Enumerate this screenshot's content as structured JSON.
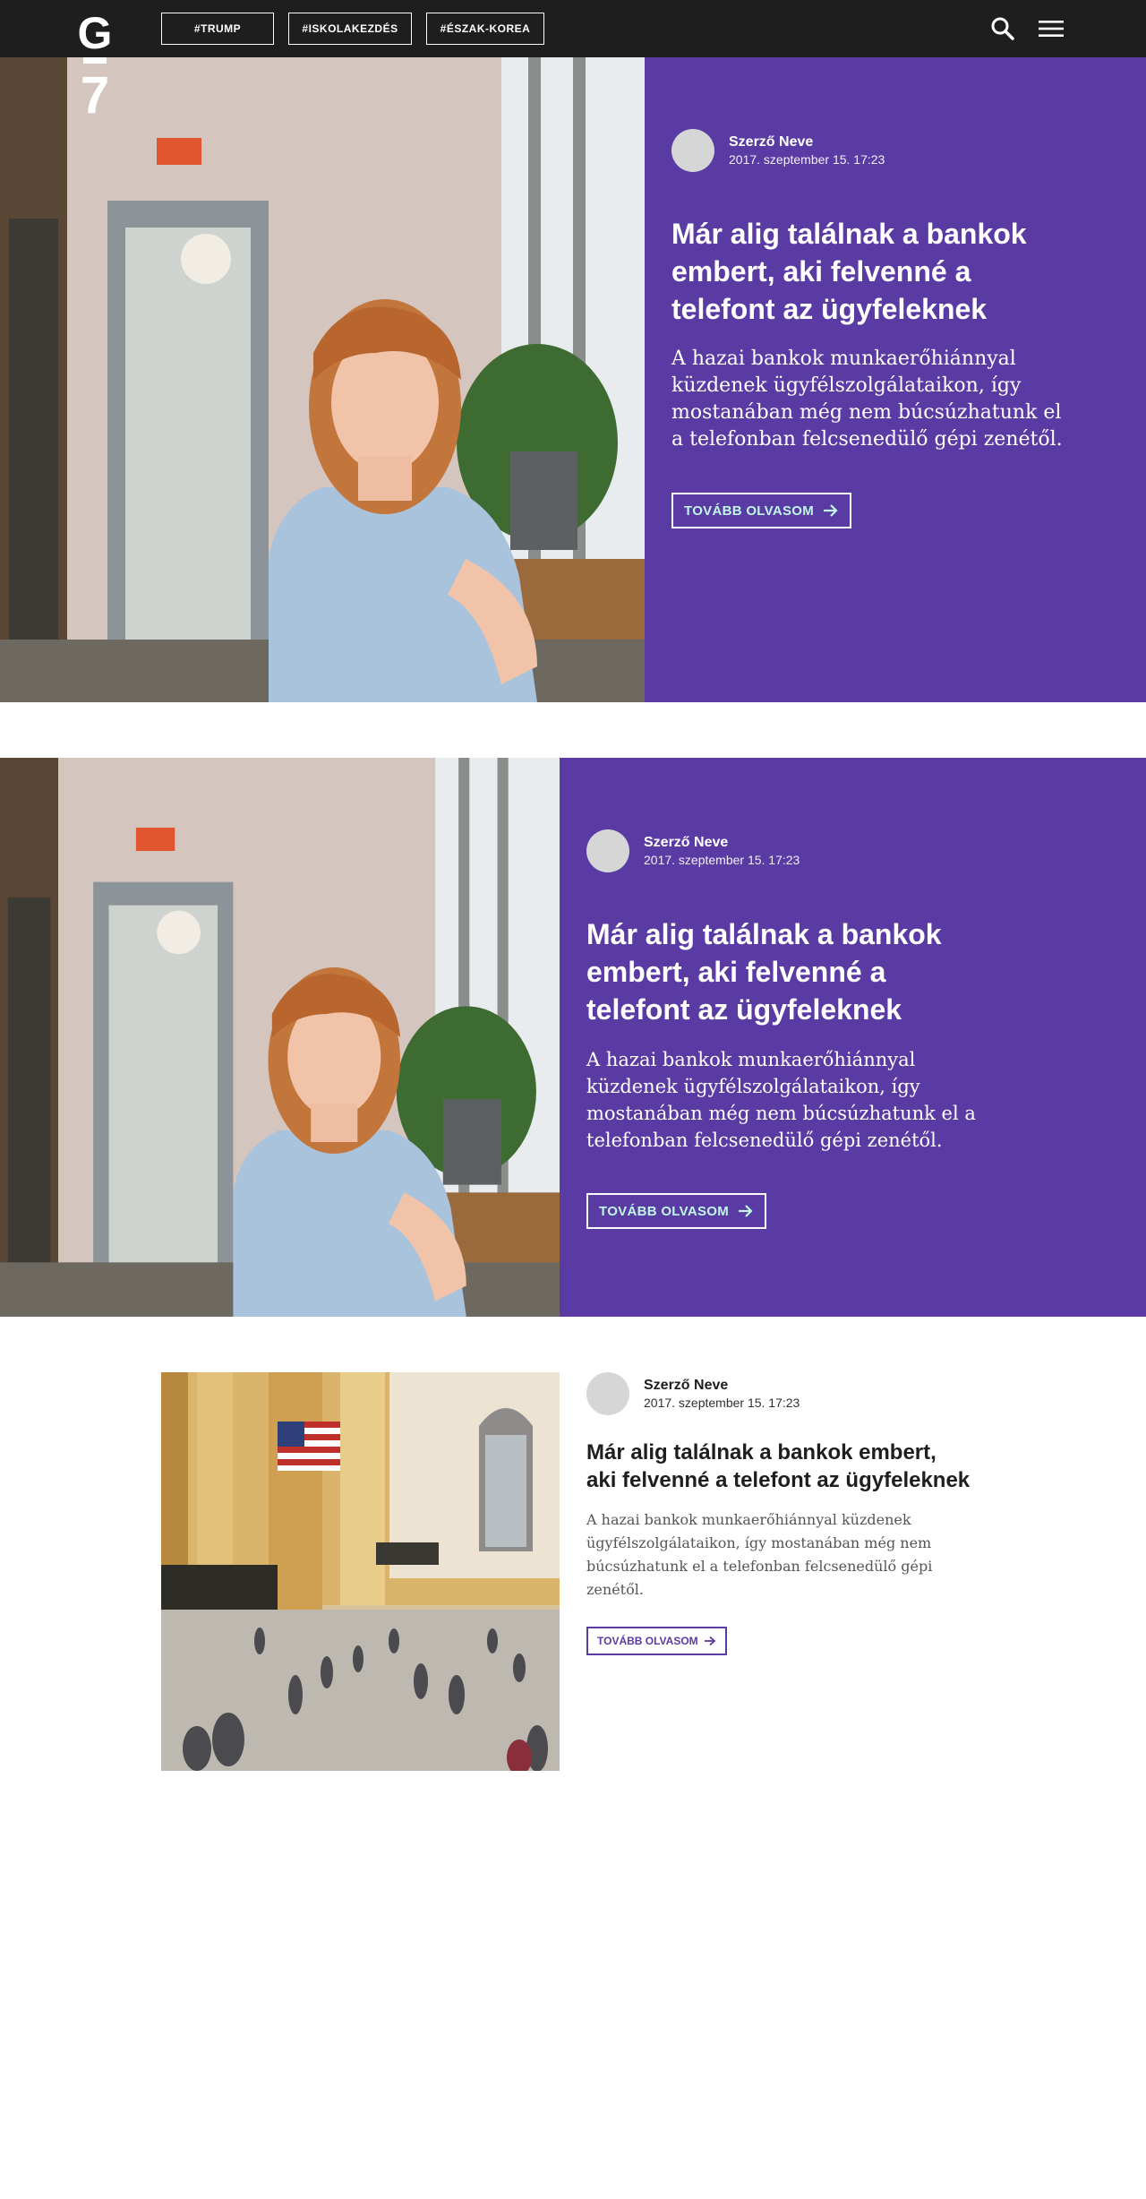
{
  "header": {
    "logo_top": "G",
    "logo_bottom": "7",
    "tags": [
      "#TRUMP",
      "#ISKOLAKEZDÉS",
      "#ÉSZAK-KOREA"
    ],
    "icons": {
      "search": "search-icon",
      "menu": "hamburger-menu-icon"
    }
  },
  "articles": [
    {
      "author": "Szerző Neve",
      "date": "2017. szeptember 15. 17:23",
      "title": "Már alig találnak a bankok embert, aki felvenné a telefont az ügyfeleknek",
      "lead": "A hazai bankok munkaerőhiánnyal küzdenek ügyfélszolgálataikon, így mostanában még nem búcsúzhatunk el a telefonban felcsenedülő gépi zenétől.",
      "read_more": "TOVÁBB OLVASOM"
    },
    {
      "author": "Szerző Neve",
      "date": "2017. szeptember 15. 17:23",
      "title": "Már alig találnak a bankok embert, aki felvenné a telefont az ügyfeleknek",
      "lead": "A hazai bankok munkaerőhiánnyal küzdenek ügyfélszolgálataikon, így mostanában még nem búcsúzhatunk el a telefonban felcsenedülő gépi zenétől.",
      "read_more": "TOVÁBB OLVASOM"
    },
    {
      "author": "Szerző Neve",
      "date": "2017. szeptember 15. 17:23",
      "title": "Már alig találnak a bankok embert, aki felvenné a telefont az ügyfeleknek",
      "lead": "A hazai bankok munkaerőhiánnyal küzdenek ügyfélszolgálataikon, így mostanában még nem búcsúzhatunk el a telefonban felcsenedülő gépi zenétől.",
      "read_more": "TOVÁBB OLVASOM"
    }
  ],
  "colors": {
    "header_bg": "#1e1e1e",
    "accent_purple": "#5a3ba3",
    "button_text_mint": "#bff5ea",
    "avatar_gray": "#d6d6d6"
  }
}
